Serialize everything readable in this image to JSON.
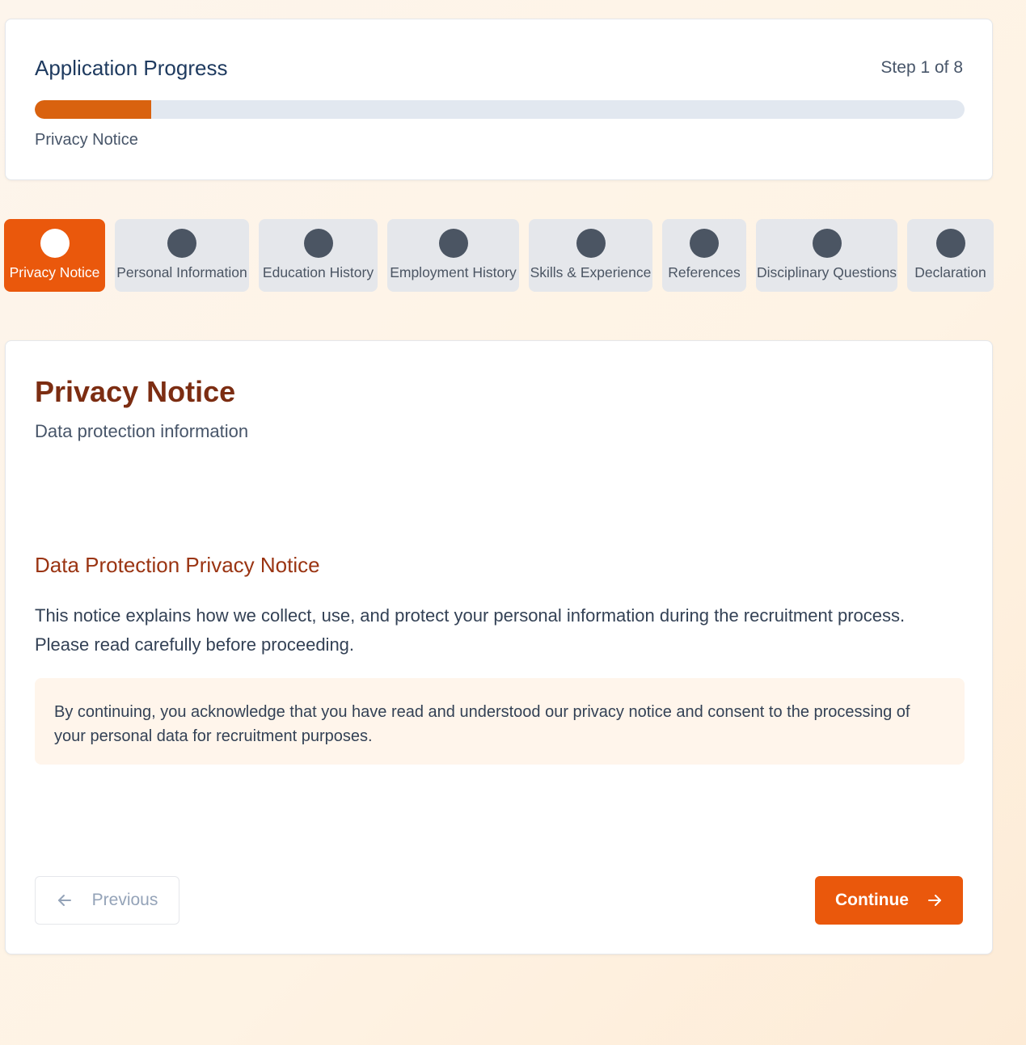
{
  "progress": {
    "title": "Application Progress",
    "step_text": "Step 1 of 8",
    "current_step_label": "Privacy Notice",
    "fraction_complete": 0.125,
    "fill_color": "#d9620f"
  },
  "steps": [
    {
      "label": "Privacy Notice",
      "active": true
    },
    {
      "label": "Personal Information",
      "active": false
    },
    {
      "label": "Education History",
      "active": false
    },
    {
      "label": "Employment History",
      "active": false
    },
    {
      "label": "Skills & Experience",
      "active": false
    },
    {
      "label": "References",
      "active": false
    },
    {
      "label": "Disciplinary Questions",
      "active": false
    },
    {
      "label": "Declaration",
      "active": false
    }
  ],
  "content": {
    "title": "Privacy Notice",
    "subtitle": "Data protection information",
    "section_heading": "Data Protection Privacy Notice",
    "section_body": "This notice explains how we collect, use, and protect your personal information during the recruitment process. Please read carefully before proceeding.",
    "acknowledgement": "By continuing, you acknowledge that you have read and understood our privacy notice and consent to the processing of your personal data for recruitment purposes."
  },
  "nav": {
    "previous_label": "Previous",
    "previous_icon": "arrow-left-icon",
    "continue_label": "Continue",
    "continue_icon": "arrow-right-icon"
  },
  "colors": {
    "accent": "#ea580c",
    "title": "#7c2d12",
    "inactive_step": "#e5e7eb"
  }
}
